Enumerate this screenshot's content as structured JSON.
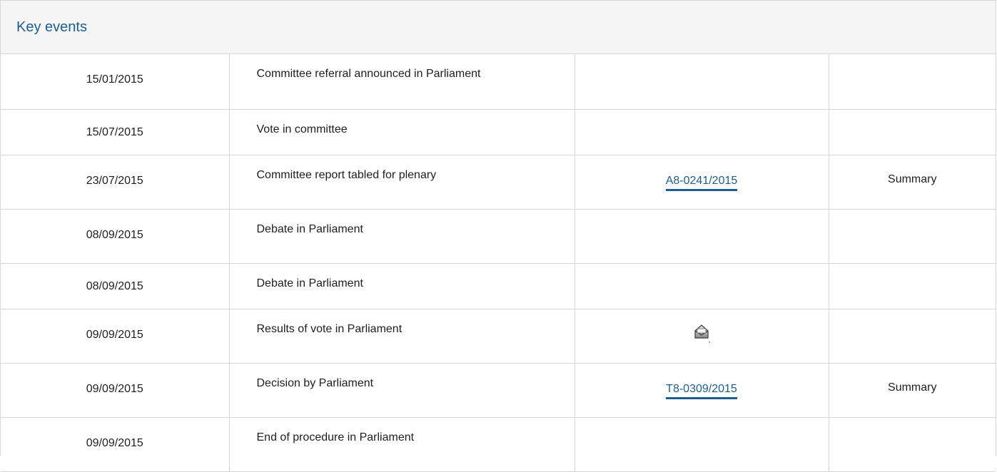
{
  "panel": {
    "title": "Key events"
  },
  "events": [
    {
      "date": "15/01/2015",
      "event": "Committee referral announced in Parliament",
      "doc": "",
      "summary": ""
    },
    {
      "date": "15/07/2015",
      "event": "Vote in committee",
      "doc": "",
      "summary": ""
    },
    {
      "date": "23/07/2015",
      "event": "Committee report tabled for plenary",
      "doc": "A8-0241/2015",
      "summary": "Summary"
    },
    {
      "date": "08/09/2015",
      "event": "Debate in Parliament",
      "doc": "",
      "summary": ""
    },
    {
      "date": "08/09/2015",
      "event": "Debate in Parliament",
      "doc": "",
      "summary": ""
    },
    {
      "date": "09/09/2015",
      "event": "Results of vote in Parliament",
      "doc_icon": "results-envelope-icon",
      "summary": ""
    },
    {
      "date": "09/09/2015",
      "event": "Decision by Parliament",
      "doc": "T8-0309/2015",
      "summary": "Summary"
    },
    {
      "date": "09/09/2015",
      "event": "End of procedure in Parliament",
      "doc": "",
      "summary": ""
    }
  ],
  "colors": {
    "link": "#1d5d94",
    "border": "#d6d6d6",
    "header_bg": "#f5f5f5"
  }
}
